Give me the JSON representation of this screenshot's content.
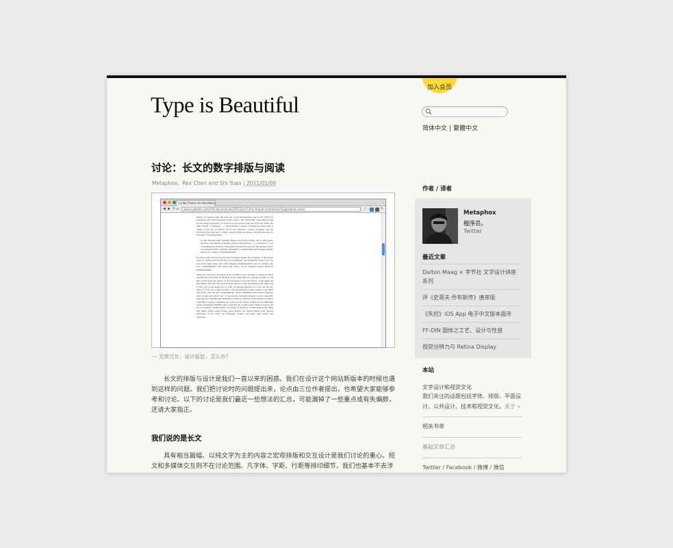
{
  "header": {
    "join_badge": "加入会员",
    "logo": "Type is Beautiful",
    "search": {
      "placeholder": "",
      "value": ""
    },
    "lang": {
      "simplified": "简体中文",
      "separator": "|",
      "traditional": "繁體中文"
    }
  },
  "article": {
    "title": "讨论：长文的数字排版与阅读",
    "authors": "Metaphox、Rex Chen and Shi Yuan",
    "meta_separator": "|",
    "date": "2011/01/09",
    "figure": {
      "browser_tab": "Le No Theme for the Markets :",
      "browser_url": "www.nybooks.com/articles/archives/2011/jan/13/no-thanks-memories/?pagination=false",
      "screen_text": [
        "Indeed, in Lepore's view the left's use of the Revolutionary past in the 1970s has pushed the Tea Party movement of the present. She claims that \"Glenn Beck wrote the Tea Party's playbook.\" In reaction to the protests from the left in the 1970s, the right created \"a resistance\" — and launched a version of American history that is taught to this day in schools and in the textbooks. Lepore recognizes that the Revolution has been put to widely varying political purposes, and there has been no shortage of Founding myths.",
        "so here freedom (the Founding Fathers) and they're telling over to their grievs because of his historic founding political development... to a subscribe to a set of assumptions about the relationship between the past and the present stories, of assumptions that conflating originalism, evangelicalism and heritage tourism, amount to a variety of fundamentalism.",
        "In other words, Lepore contends, the Tea Parties regard \"the founding\" of the United States as \"ageless and sacred and to be worshiped,\" and its historical texts \"not to be read in the same spirit with which religious fundamentalists read, for instance, the Ten Commandments.\" Her book, she writes, \"is an argument against historical fundamentalism.\"",
        "When the Tea Party movement arose in 2009, Lepore decided to attend its rallies and interview its leaders in the Boston area where she lives and put together a book that would reveal the history of the movement as the true history of the American Revolution. She adds that the Tea Party's rhetoric of the Revolution in the 1960s and 1770s, such as the Stamp Act of 1765, the Boston Massacre of 1770, and the Tea Party of 1773, are brought forward to the bicentennial of those events in the 1960s and 1970s, with the aim of highlighting \"what's remembered and what's forgotten, what is kept and what's lost.\" It has proved confusing enough. Lepore repeatedly interrupts the remembering meditation on history with bits of information on topics, sometimes relevant, sometimes not, such as John Adams, printing in the eighteenth century, Benjamin Franklin's sister, Jane Mecom, and her many children, slavery, the US Constitution, Thomas Paine, the pledge of allegiance, abolitionism in the 1800s and 1900s, Stieb's school Penny, paper makers, the Samuel Heard scale, Boston ethnicities of the 1970s, the Watergate scandal, and many other events and characters."
      ]
    },
    "caption": "— 文章冗长，设计尴尬，怎么办？",
    "intro": "长文的排版与设计是我们一直以来的困惑。我们在设计这个网站新版本的时候也遇到这样的问题。我们把讨论时的问题提出来，论点由三位作者提出，也希望大家能够参考和讨论。以下的讨论是我们最近一些想法的汇总，可能漏掉了一些重点或有失偏颇，还请大家指正。",
    "section_heading": "我们说的是长文",
    "section_text": "具有相当篇幅、以纯文字为主的内容之宏观排版和交互设计是我们讨论的重心。短文和多媒体交互则不在讨论范围。凡字体、字距、行距等排印细节，我们也基本不去涉"
  },
  "sidebar": {
    "authors_heading": "作者 / 译者",
    "author": {
      "name": "Metaphox",
      "role": "程序员。",
      "twitter": "Twitter"
    },
    "recent_heading": "最近文章",
    "recent": [
      "Dalton Maag × 字节社 文学设计讲座系列",
      "评《史蒂夫·乔布斯传》唐茶版",
      "《失控》iOS App 电子中文版本面市",
      "FF-DIN 圆体之工艺、设计与性感",
      "视觉分辨力与 Retina Display"
    ],
    "site_heading": "本站",
    "site": {
      "desc_title": "文字设计和视觉文化",
      "desc": "我们关注的话题包括字体、排版、平面设计、公共设计、技术和视觉文化。",
      "about": "关于 »",
      "booklist": "相关书单",
      "basics": "基础文章汇总",
      "social": [
        "Twitter",
        "Facebook",
        "微博",
        "微信"
      ],
      "social_sep": " / "
    }
  },
  "colors": {
    "page_bg": "#f7f7f4",
    "badge": "#ffd93b",
    "panel_bg": "#e6e6e4",
    "top_rule": "#111111"
  }
}
